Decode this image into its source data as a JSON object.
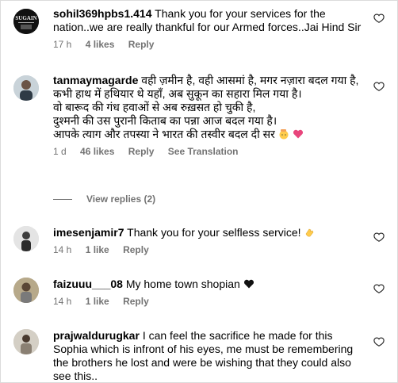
{
  "colors": {
    "text": "#000000",
    "meta": "#737373",
    "heart_red": "#ed2a5a",
    "border": "#dbdbdb"
  },
  "comments": [
    {
      "username": "sohil369hpbs1.414",
      "text": "Thank you for your services for the nation..we are really thankful for our Armed forces..Jai Hind Sir",
      "time": "17 h",
      "likes": "4 likes",
      "reply": "Reply",
      "avatar_icon": "logo-avatar"
    },
    {
      "username": "tanmaymagarde",
      "text": "वही ज़मीन है, वही आसमां है, मगर नज़ारा बदल गया है,\nकभी हाथ में हथियार थे यहाँ, अब सुकून का सहारा मिल गया है।\nवो बारूद की गंध हवाओं से अब रुख़सत हो चुकी है,\nदुश्मनी की उस पुरानी किताब का पन्ना आज बदल गया है।\nआपके त्याग और तपस्या ने भारत की तस्वीर बदल दी सर",
      "time": "1 d",
      "likes": "46 likes",
      "reply": "Reply",
      "see_translation": "See Translation",
      "view_replies": "View replies (2)",
      "trailing_emojis": [
        "salute-face-emoji",
        "pink-heart-emoji"
      ]
    },
    {
      "username": "imesenjamir7",
      "text": "Thank you for your selfless service!",
      "time": "14 h",
      "likes": "1 like",
      "reply": "Reply",
      "trailing_emojis": [
        "clapping-hand-emoji"
      ]
    },
    {
      "username": "faizuuu___08",
      "text": "My home town shopian",
      "time": "14 h",
      "likes": "1 like",
      "reply": "Reply",
      "trailing_emojis": [
        "black-heart-emoji"
      ]
    },
    {
      "username": "prajwaldurugkar",
      "text": "I can feel the sacrifice he made for this Sophia which is infront of his eyes, me must be remembering the brothers he lost and were be wishing that they could also see this..",
      "time": "",
      "likes": "",
      "reply": ""
    }
  ]
}
